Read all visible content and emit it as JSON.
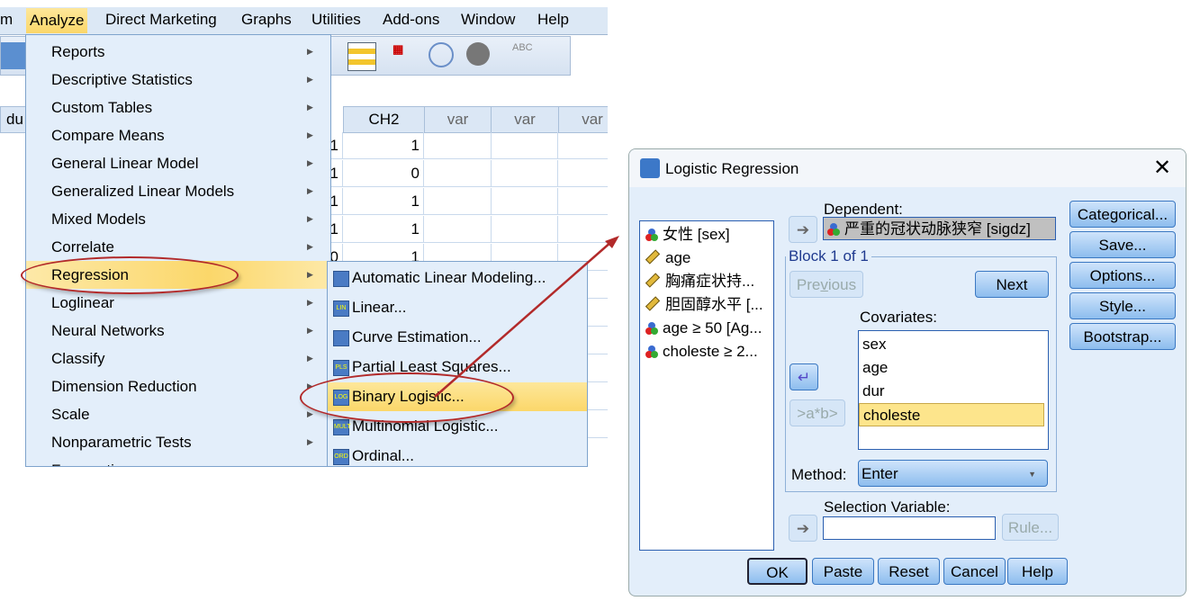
{
  "menubar": {
    "items": [
      "m",
      "Analyze",
      "Direct Marketing",
      "Graphs",
      "Utilities",
      "Add-ons",
      "Window",
      "Help"
    ]
  },
  "grid": {
    "headers": [
      "du",
      "CH2",
      "var",
      "var",
      "var"
    ],
    "prev_col": [
      "1",
      "1",
      "1",
      "1",
      "0"
    ],
    "ch2_col": [
      "1",
      "0",
      "1",
      "1",
      "1"
    ]
  },
  "analyze_menu": {
    "items": [
      "Reports",
      "Descriptive Statistics",
      "Custom Tables",
      "Compare Means",
      "General Linear Model",
      "Generalized Linear Models",
      "Mixed Models",
      "Correlate",
      "Regression",
      "Loglinear",
      "Neural Networks",
      "Classify",
      "Dimension Reduction",
      "Scale",
      "Nonparametric Tests",
      "Forecasting"
    ],
    "highlighted": "Regression"
  },
  "regression_submenu": {
    "items": [
      {
        "label": "Automatic Linear Modeling...",
        "icon": "auto-linear-icon"
      },
      {
        "label": "Linear...",
        "icon": "LIN"
      },
      {
        "label": "Curve Estimation...",
        "icon": "curve-icon"
      },
      {
        "label": "Partial Least Squares...",
        "icon": "PLS"
      },
      {
        "label": "Binary Logistic...",
        "icon": "LOG"
      },
      {
        "label": "Multinomial Logistic...",
        "icon": "MULT"
      },
      {
        "label": "Ordinal...",
        "icon": "ORD"
      }
    ],
    "highlighted": "Binary Logistic..."
  },
  "dialog": {
    "title": "Logistic Regression",
    "variables": [
      {
        "label": "女性 [sex]",
        "type": "nominal"
      },
      {
        "label": "age",
        "type": "scale"
      },
      {
        "label": "胸痛症状持...",
        "type": "scale"
      },
      {
        "label": "胆固醇水平 [...",
        "type": "scale"
      },
      {
        "label": "age ≥ 50 [Ag...",
        "type": "nominal"
      },
      {
        "label": "choleste ≥ 2...",
        "type": "nominal"
      }
    ],
    "dependent_label": "Dependent:",
    "dependent_value": "严重的冠状动脉狭窄 [sigdz]",
    "block_label": "Block 1 of 1",
    "previous": "Previous",
    "next": "Next",
    "covariates_label": "Covariates:",
    "covariates": [
      "sex",
      "age",
      "dur",
      "choleste"
    ],
    "selected_covariate": "choleste",
    "interaction": ">a*b>",
    "method_label": "Method:",
    "method_value": "Enter",
    "selection_label": "Selection Variable:",
    "selection_value": "",
    "rule": "Rule...",
    "side_buttons": [
      "Categorical...",
      "Save...",
      "Options...",
      "Style...",
      "Bootstrap..."
    ],
    "bottom_buttons": [
      "OK",
      "Paste",
      "Reset",
      "Cancel",
      "Help"
    ]
  },
  "colors": {
    "highlight": "#fbd76a",
    "annotation": "#b22a2a",
    "menu_bg": "#e3eefa"
  }
}
